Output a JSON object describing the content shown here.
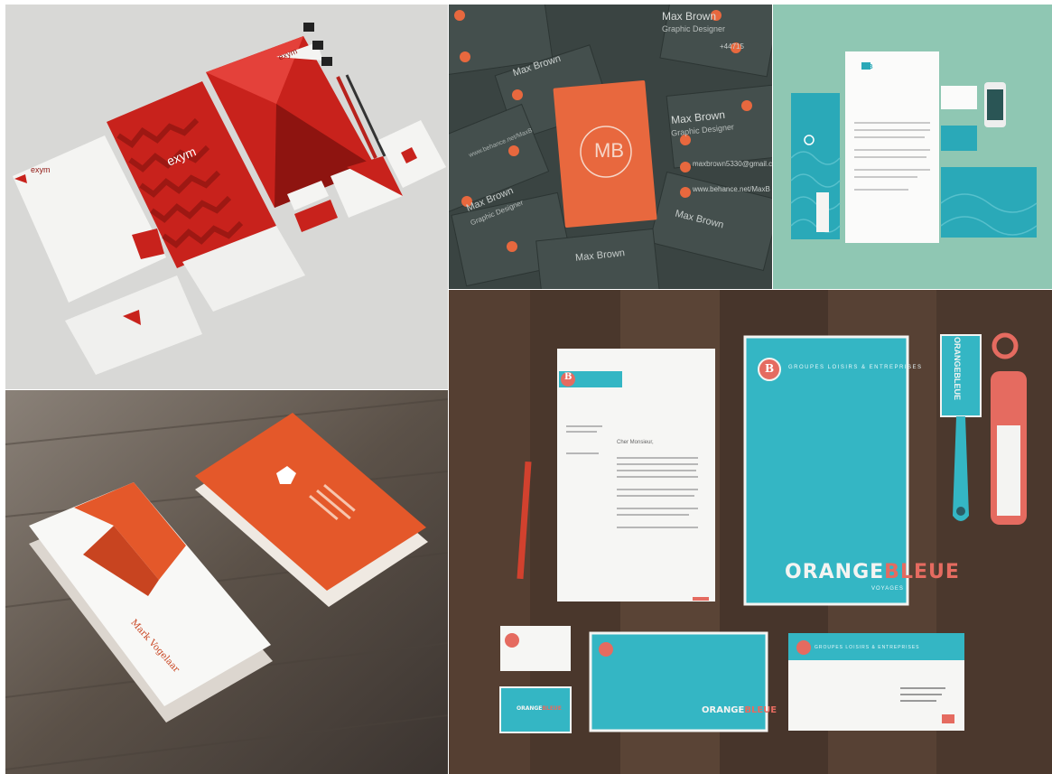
{
  "exym": {
    "brand": "exym",
    "colors": {
      "bg": "#d8d8d6",
      "red": "#c8221c",
      "dark_red": "#8e1410",
      "paper": "#f4f4f2"
    }
  },
  "maxbrown": {
    "monogram": "MB",
    "name": "Max Brown",
    "role": "Graphic Designer",
    "email": "maxbrown5330@gmail.com",
    "web": "www.behance.net/MaxB",
    "phone": "+44715",
    "colors": {
      "bg": "#3a4442",
      "card": "#e8683e"
    }
  },
  "teal": {
    "brand_short": "GB",
    "colors": {
      "bg": "#8fc7b3",
      "teal": "#2aa9b8"
    }
  },
  "mark": {
    "name": "Mark Vogelaar",
    "colors": {
      "wood": "#5b5148",
      "orange": "#e4582a"
    }
  },
  "orangebleue": {
    "brand": "ORANGEBLEUE",
    "brand_orange": "ORANGE",
    "brand_bleue": "BLEUE",
    "tagline": "VOYAGES",
    "header_line": "GROUPES LOISIRS & ENTREPRISES",
    "letter_greeting": "Cher Monsieur,",
    "monogram": "B",
    "colors": {
      "wood": "#4a3a30",
      "cyan": "#34b6c4",
      "coral": "#e56b60"
    }
  }
}
